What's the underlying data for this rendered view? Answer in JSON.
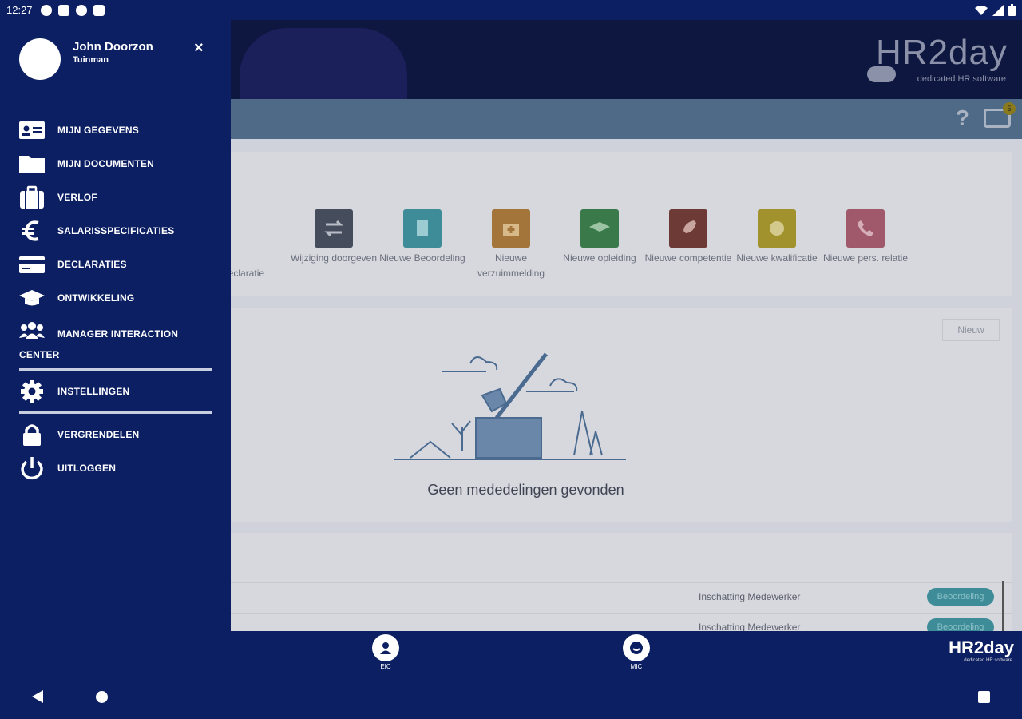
{
  "status_bar": {
    "time": "12:27"
  },
  "header": {
    "logo": "HR2day",
    "tagline": "dedicated HR software"
  },
  "toolbar": {
    "help": "?",
    "inbox_count": "5"
  },
  "tiles": [
    {
      "label": "e declaratie",
      "color": "#2f5a88"
    },
    {
      "label": "Wijziging doorgeven",
      "color": "#454c5c"
    },
    {
      "label": "Nieuwe Beoordeling",
      "color": "#3f8c99"
    },
    {
      "label": "Nieuwe verzuimmelding",
      "color": "#a4753a"
    },
    {
      "label": "Nieuwe opleiding",
      "color": "#3a7a4a"
    },
    {
      "label": "Nieuwe competentie",
      "color": "#6e3a35"
    },
    {
      "label": "Nieuwe kwalificatie",
      "color": "#a2922e"
    },
    {
      "label": "Nieuwe pers. relatie",
      "color": "#a0596a"
    }
  ],
  "announcements": {
    "new_button": "Nieuw",
    "empty_text": "Geen mededelingen gevonden"
  },
  "tasks": [
    {
      "label": "Inschatting Medewerker",
      "badge": "Beoordeling"
    },
    {
      "label": "Inschatting Medewerker",
      "badge": "Beoordeling"
    }
  ],
  "bottom_nav": {
    "left_label": "EIC",
    "right_label": "MIC",
    "logo": "HR2day",
    "logo_sub": "dedicated HR software"
  },
  "drawer": {
    "user_name": "John Doorzon",
    "user_role": "Tuinman",
    "close": "×",
    "items": [
      {
        "label": "MIJN GEGEVENS",
        "icon": "id-card-icon"
      },
      {
        "label": "MIJN DOCUMENTEN",
        "icon": "folder-icon"
      },
      {
        "label": "VERLOF",
        "icon": "suitcase-icon"
      },
      {
        "label": "SALARISSPECIFICATIES",
        "icon": "euro-icon"
      },
      {
        "label": "DECLARATIES",
        "icon": "credit-card-icon"
      },
      {
        "label": "ONTWIKKELING",
        "icon": "graduation-cap-icon"
      },
      {
        "label": "MANAGER INTERACTION CENTER",
        "icon": "users-icon"
      },
      {
        "label": "INSTELLINGEN",
        "icon": "gear-icon"
      },
      {
        "label": "VERGRENDELEN",
        "icon": "lock-icon"
      },
      {
        "label": "UITLOGGEN",
        "icon": "power-icon"
      }
    ]
  }
}
